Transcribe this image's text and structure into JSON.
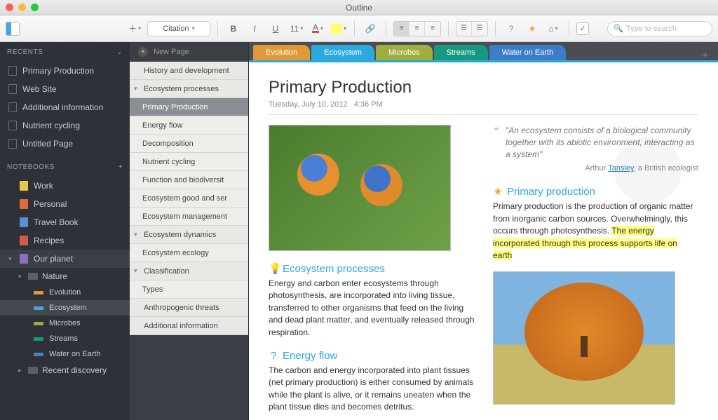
{
  "window": {
    "title": "Outline"
  },
  "toolbar": {
    "style_select": "Citation",
    "font_size": "11",
    "search_placeholder": "Type to search"
  },
  "sidebar": {
    "recents_header": "RECENTS",
    "recents": [
      "Primary Production",
      "Web Site",
      "Additional information",
      "Nutrient cycling",
      "Untitled Page"
    ],
    "notebooks_header": "NOTEBOOKS",
    "notebooks": [
      {
        "label": "Work",
        "color": "#e6c84a"
      },
      {
        "label": "Personal",
        "color": "#e06a3a"
      },
      {
        "label": "Travel Book",
        "color": "#5a8fd6"
      },
      {
        "label": "Recipes",
        "color": "#d65a4a"
      },
      {
        "label": "Our planet",
        "color": "#8a6fbf",
        "open": true
      }
    ],
    "sections": [
      {
        "label": "Nature",
        "children": [
          {
            "label": "Evolution",
            "color": "#e0993a"
          },
          {
            "label": "Ecosystem",
            "color": "#4aa6d6",
            "selected": true
          },
          {
            "label": "Microbes",
            "color": "#9fae3d"
          },
          {
            "label": "Streams",
            "color": "#159a7f"
          },
          {
            "label": "Water on Earth",
            "color": "#4a7fc9"
          }
        ]
      },
      {
        "label": "Recent discovery"
      }
    ]
  },
  "outline": {
    "new_page": "New Page",
    "items": [
      {
        "label": "History and development",
        "lvl": 0
      },
      {
        "label": "Ecosystem processes",
        "lvl": 0,
        "exp": true
      },
      {
        "label": "Primary Production",
        "lvl": 1,
        "selected": true
      },
      {
        "label": "Energy flow",
        "lvl": 1
      },
      {
        "label": "Decomposition",
        "lvl": 1
      },
      {
        "label": "Nutrient cycling",
        "lvl": 1
      },
      {
        "label": "Function and biodiversit",
        "lvl": 1
      },
      {
        "label": "Ecosystem good and ser",
        "lvl": 1
      },
      {
        "label": "Ecosystem management",
        "lvl": 1
      },
      {
        "label": "Ecosystem dynamics",
        "lvl": 0,
        "exp": true
      },
      {
        "label": "Ecosystem ecology",
        "lvl": 1
      },
      {
        "label": "Classification",
        "lvl": 0,
        "exp": true
      },
      {
        "label": "Types",
        "lvl": 1
      },
      {
        "label": "Anthropogenic threats",
        "lvl": 0
      },
      {
        "label": "Additional information",
        "lvl": 0
      }
    ]
  },
  "tabs": [
    "Evolution",
    "Ecosystem",
    "Microbes",
    "Streams",
    "Water on Earth"
  ],
  "page": {
    "title": "Primary Production",
    "date": "Tuesday, July 10, 2012",
    "time": "4:36 PM",
    "quote": "\"An ecosystem consists of a biological community together with its abiotic environment, interacting as a system\"",
    "attribution_pre": "Arthur ",
    "attribution_link": "Tansley",
    "attribution_post": ", a British ecologist",
    "sec1": {
      "title": "Primary production",
      "body_pre": "Primary production is the production of organic matter from inorganic carbon sources. Overwhelmingly, this occurs through photosynthesis. ",
      "body_hl": "The energy incorporated through this process supports life on earth"
    },
    "sec2": {
      "title": "Ecosystem processes",
      "body": "Energy and carbon enter ecosystems through photosynthesis, are incorporated into living tissue, transferred to other organisms that feed on the living and dead plant matter, and eventually released through respiration."
    },
    "sec3": {
      "title": "Energy flow",
      "body": "The carbon and energy incorporated into plant tissues (net primary production) is either consumed by animals while the plant is alive, or it remains uneaten when the plant tissue dies and becomes detritus."
    }
  }
}
